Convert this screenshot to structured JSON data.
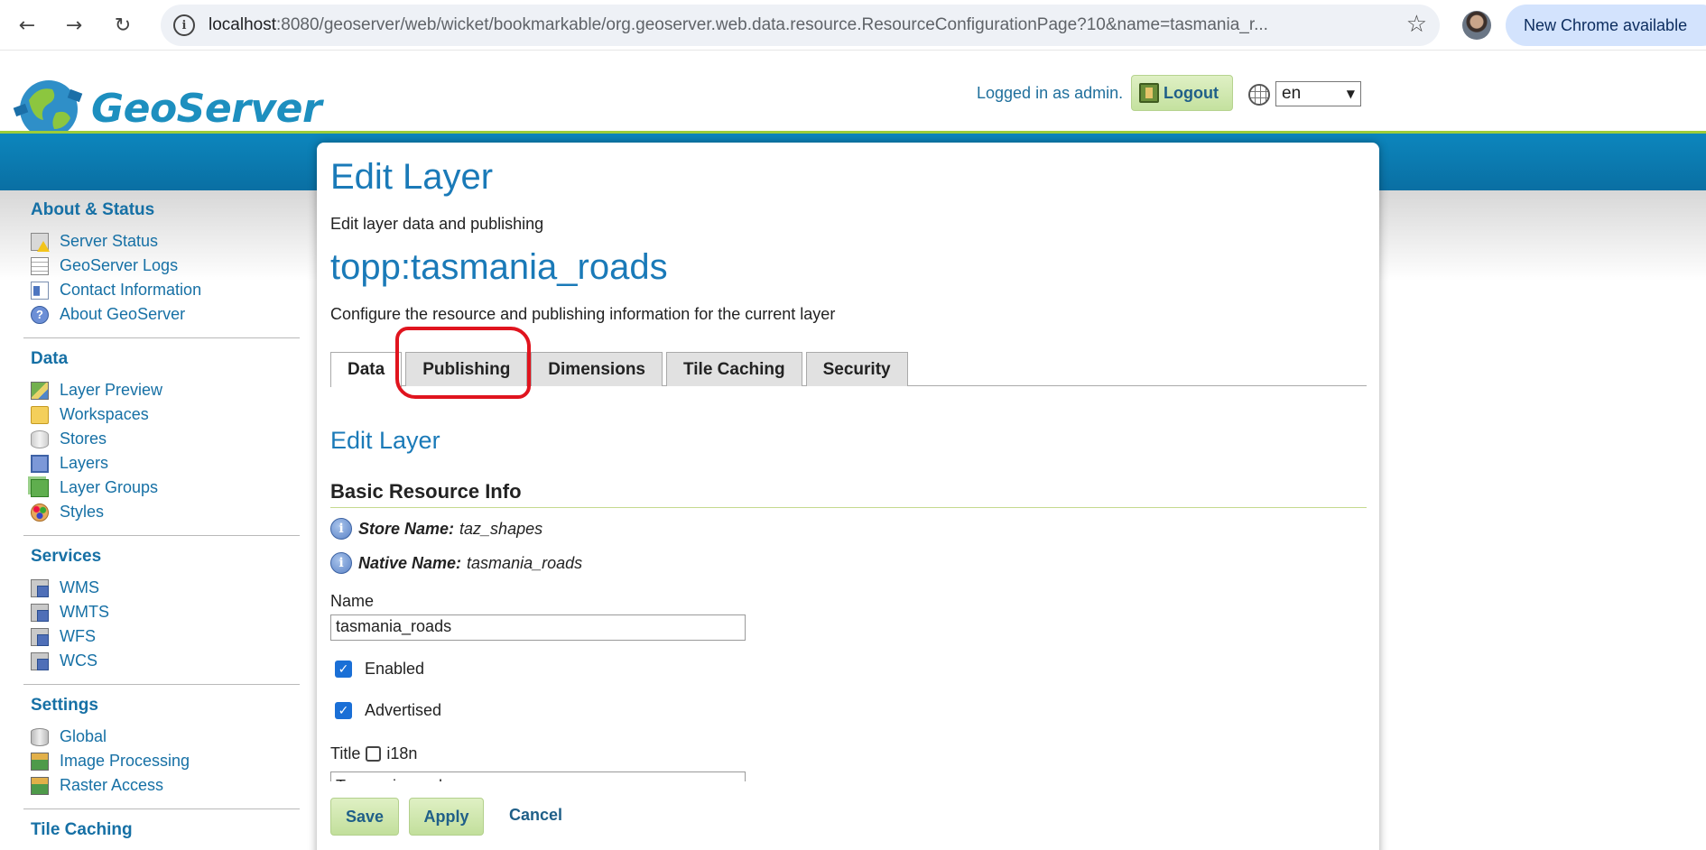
{
  "browser": {
    "url_host": "localhost",
    "url_path": ":8080/geoserver/web/wicket/bookmarkable/org.geoserver.web.data.resource.ResourceConfigurationPage?10&name=tasmania_r...",
    "update_label": "New Chrome available",
    "back_icon": "←",
    "forward_icon": "→",
    "reload_icon": "↻",
    "info_icon": "i",
    "star_icon": "☆"
  },
  "header": {
    "logo_text": "GeoServer",
    "login_status": "Logged in as admin.",
    "logout_label": "Logout",
    "language": "en"
  },
  "sidebar": {
    "sections": [
      {
        "heading": "About & Status",
        "items": [
          "Server Status",
          "GeoServer Logs",
          "Contact Information",
          "About GeoServer"
        ]
      },
      {
        "heading": "Data",
        "items": [
          "Layer Preview",
          "Workspaces",
          "Stores",
          "Layers",
          "Layer Groups",
          "Styles"
        ]
      },
      {
        "heading": "Services",
        "items": [
          "WMS",
          "WMTS",
          "WFS",
          "WCS"
        ]
      },
      {
        "heading": "Settings",
        "items": [
          "Global",
          "Image Processing",
          "Raster Access"
        ]
      },
      {
        "heading": "Tile Caching",
        "items": []
      }
    ]
  },
  "main": {
    "title": "Edit Layer",
    "subtitle": "Edit layer data and publishing",
    "layer_name": "topp:tasmania_roads",
    "layer_desc": "Configure the resource and publishing information for the current layer",
    "tabs": [
      "Data",
      "Publishing",
      "Dimensions",
      "Tile Caching",
      "Security"
    ],
    "active_tab": "Data",
    "section_title": "Edit Layer",
    "subsection_title": "Basic Resource Info",
    "store_name_label": "Store Name:",
    "store_name_value": "taz_shapes",
    "native_name_label": "Native Name:",
    "native_name_value": "tasmania_roads",
    "name_label": "Name",
    "name_value": "tasmania_roads",
    "enabled_label": "Enabled",
    "advertised_label": "Advertised",
    "title_label": "Title",
    "i18n_label": "i18n",
    "title_value": "Tasmania roads",
    "save_label": "Save",
    "apply_label": "Apply",
    "cancel_label": "Cancel"
  },
  "colors": {
    "accent": "#1a7ab8",
    "band_blue": "#0a6fa3",
    "band_green": "#9ccc3a",
    "highlight": "#e0141e"
  }
}
